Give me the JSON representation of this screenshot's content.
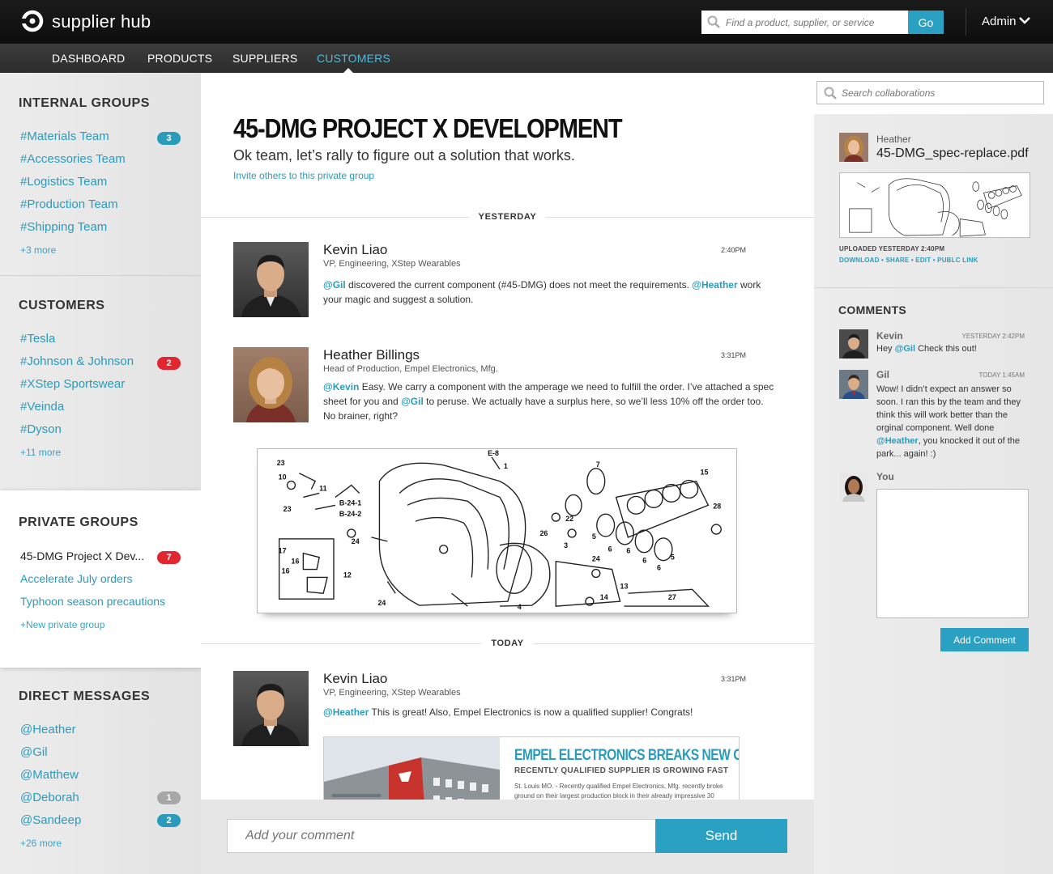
{
  "header": {
    "brand": "supplier hub",
    "search_placeholder": "Find a product, supplier, or service",
    "go_label": "Go",
    "user_label": "Admin"
  },
  "nav": {
    "items": [
      {
        "label": "DASHBOARD"
      },
      {
        "label": "PRODUCTS"
      },
      {
        "label": "SUPPLIERS"
      },
      {
        "label": "CUSTOMERS",
        "active": true
      }
    ]
  },
  "sidebar": {
    "internal_groups": {
      "title": "INTERNAL GROUPS",
      "items": [
        {
          "label": "#Materials Team",
          "badge": "3"
        },
        {
          "label": "#Accessories Team"
        },
        {
          "label": "#Logistics Team"
        },
        {
          "label": "#Production Team"
        },
        {
          "label": "#Shipping Team"
        }
      ],
      "more": "+3 more"
    },
    "customers": {
      "title": "CUSTOMERS",
      "items": [
        {
          "label": "#Tesla"
        },
        {
          "label": "#Johnson & Johnson",
          "badge": "2"
        },
        {
          "label": "#XStep Sportswear"
        },
        {
          "label": "#Veinda"
        },
        {
          "label": "#Dyson"
        }
      ],
      "more": "+11 more"
    },
    "private_groups": {
      "title": "PRIVATE GROUPS",
      "items": [
        {
          "label": "45-DMG Project X Dev...",
          "badge": "7"
        },
        {
          "label": "Accelerate July orders"
        },
        {
          "label": "Typhoon season precautions"
        }
      ],
      "more": "+New private group"
    },
    "direct_messages": {
      "title": "DIRECT MESSAGES",
      "items": [
        {
          "label": "@Heather"
        },
        {
          "label": "@Gil"
        },
        {
          "label": "@Matthew"
        },
        {
          "label": "@Deborah",
          "badge": "1"
        },
        {
          "label": "@Sandeep",
          "badge": "2"
        }
      ],
      "more": "+26 more"
    }
  },
  "main": {
    "title": "45-DMG PROJECT X DEVELOPMENT",
    "subtitle": "Ok team, let’s rally to figure out a solution that works.",
    "invite": "Invite others to this private group",
    "day_yesterday": "YESTERDAY",
    "day_today": "TODAY",
    "posts": [
      {
        "name": "Kevin Liao",
        "role": "VP, Engineering, XStep Wearables",
        "time": "2:40PM",
        "m1": "@Gil",
        "t1": " discovered the current component (#45-DMG) does not meet the requirements. ",
        "m2": "@Heather",
        "t2": " work your magic and suggest a solution."
      },
      {
        "name": "Heather Billings",
        "role": "Head of Production, Empel Electronics, Mfg.",
        "time": "3:31PM",
        "m1": "@Kevin",
        "t1": " Easy. We carry a component with the amperage we need to fulfill the order. I’ve attached a spec sheet for you and ",
        "m2": "@Gil",
        "t2": " to peruse. We actually have a surplus here, so we’ll less 10% off the order too. No brainer, right?"
      },
      {
        "name": "Kevin Liao",
        "role": "VP, Engineering, XStep Wearables",
        "time": "3:31PM",
        "m1": "@Heather",
        "t1": " This is great!  Also, Empel Electronics is now a qualified supplier! Congrats!"
      }
    ],
    "news": {
      "title": "EMPEL ELECTRONICS BREAKS NEW GROUND",
      "subtitle": "RECENTLY QUALIFIED SUPPLIER IS GROWING FAST",
      "text": "St. Louis MO. -  Recently qualified Empel Electronics, Mfg. recently broke ground on their largest production block in their already impressive 30"
    }
  },
  "composer": {
    "placeholder": "Add your comment",
    "send_label": "Send"
  },
  "right": {
    "search_placeholder": "Search collaborations",
    "file": {
      "user": "Heather",
      "name": "45-DMG_spec-replace.pdf",
      "uploaded": "UPLOADED YESTERDAY 2:40PM",
      "links": "DOWNLOAD • SHARE • EDIT • PUBLC LINK"
    },
    "comments_title": "COMMENTS",
    "comments": [
      {
        "name": "Kevin",
        "time": "YESTERDAY 2:42PM",
        "m1": "@Gil",
        "t0": "Hey ",
        "t1": " Check this out!"
      },
      {
        "name": "Gil",
        "time": "TODAY 1:45AM",
        "t0": "Wow! I didn’t expect an answer so soon. I ran this by the team and they think this will work better than the orginal component. Well done ",
        "m1": "@Heather",
        "t1": ", you knocked it out of the park... again! :)"
      }
    ],
    "you_label": "You",
    "add_comment_label": "Add Comment"
  },
  "colors": {
    "accent": "#2aa0c2",
    "badge_red": "#e0262f",
    "badge_gray": "#a7a7a7"
  }
}
